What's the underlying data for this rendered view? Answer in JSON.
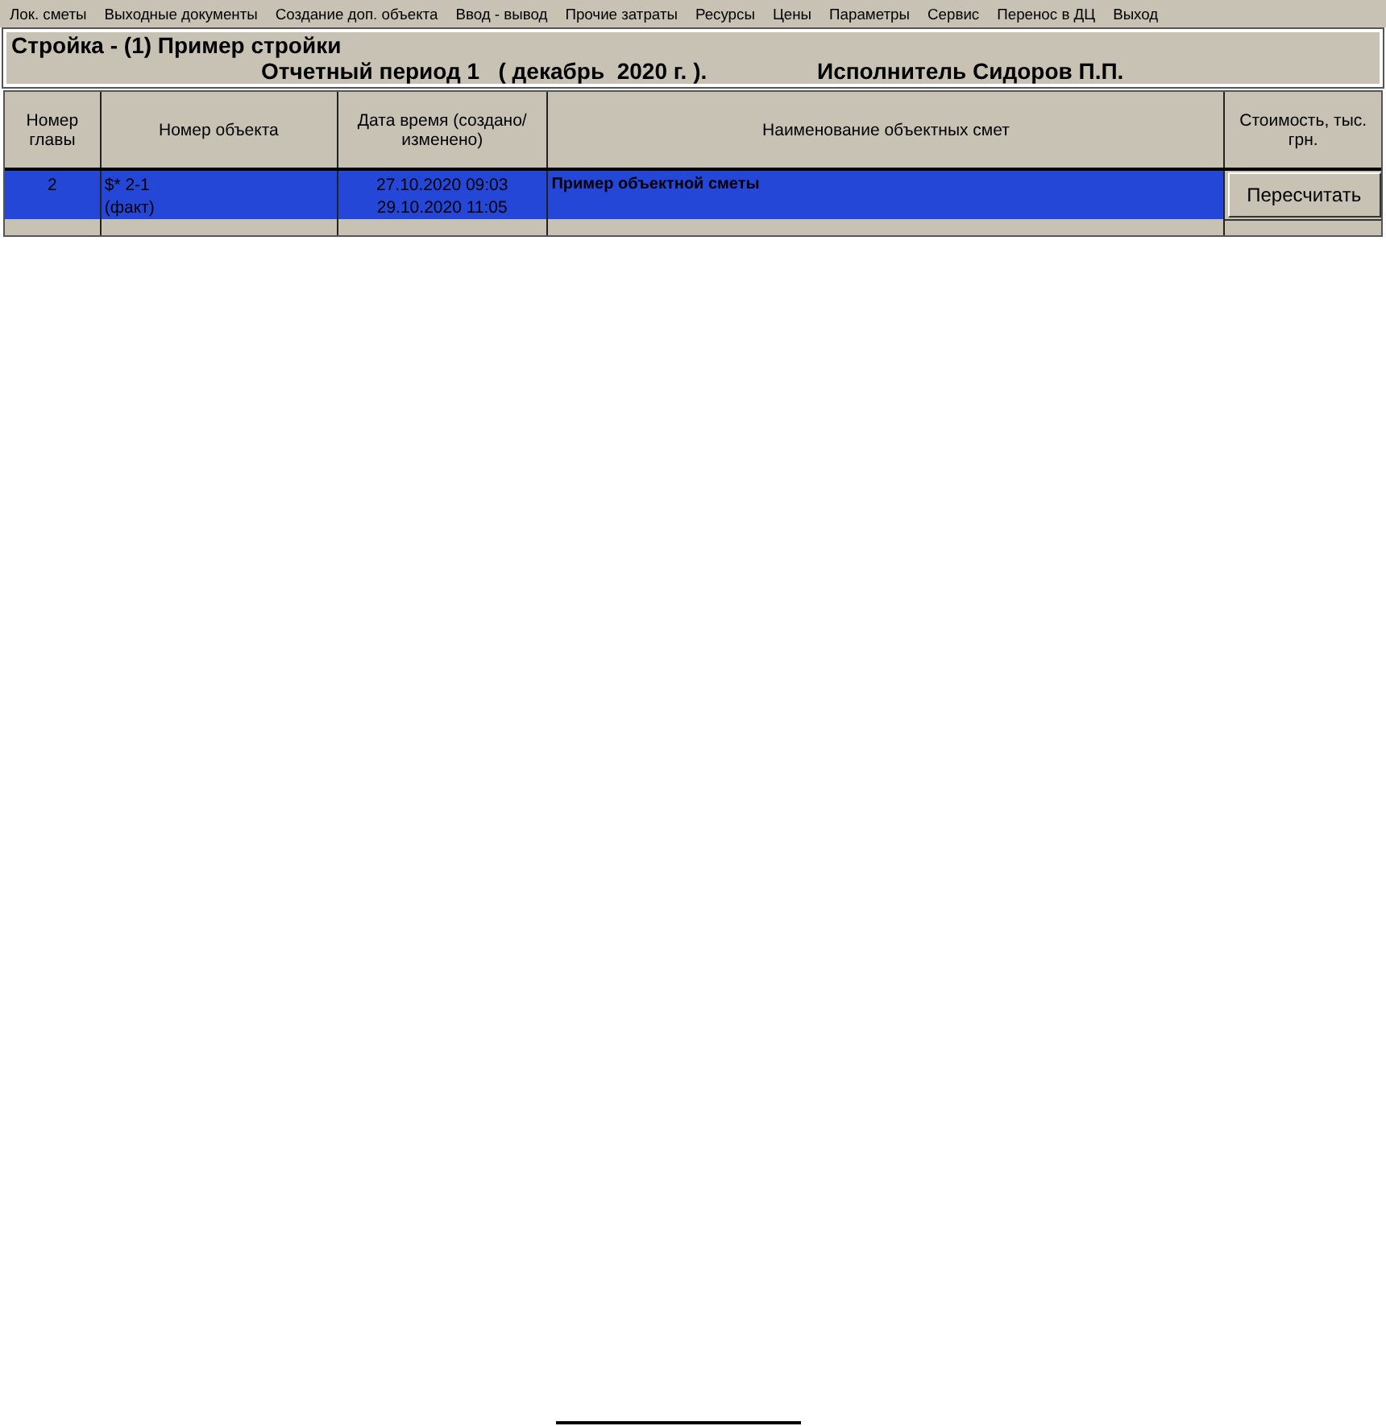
{
  "menu": [
    "Лок. сметы",
    "Выходные документы",
    "Создание  доп. объекта",
    "Ввод - вывод",
    "Прочие затраты",
    "Ресурсы",
    "Цены",
    "Параметры",
    "Сервис",
    "Перенос в ДЦ",
    "Выход"
  ],
  "header": {
    "title": "Стройка - (1) Пример стройки",
    "period": "Отчетный период 1   ( декабрь  2020 г. ).",
    "executor": "Исполнитель Сидоров П.П."
  },
  "table": {
    "columns": [
      "Номер главы",
      "Номер объекта",
      "Дата время (создано/ изменено)",
      "Наименование объектных смет",
      "Стоимость, тыс. грн."
    ],
    "rows": [
      {
        "chapter": "2",
        "object": [
          "$* 2-1",
          "(факт)"
        ],
        "dates": [
          "27.10.2020 09:03",
          "29.10.2020 11:05"
        ],
        "name": "Пример объектной сметы",
        "action": "Пересчитать",
        "selected": true
      }
    ]
  }
}
